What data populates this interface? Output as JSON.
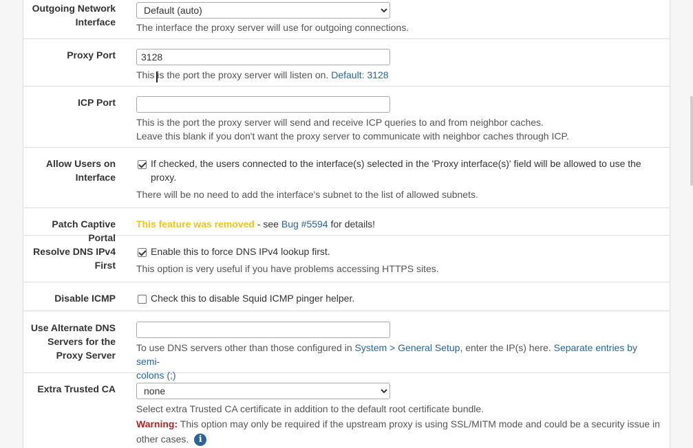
{
  "fields": {
    "outgoing_iface": {
      "label_line1": "Outgoing Network",
      "label_line2": "Interface",
      "selected": "Default (auto)",
      "help": "The interface the proxy server will use for outgoing connections."
    },
    "proxy_port": {
      "label": "Proxy Port",
      "value": "3128",
      "help": "This is the port the proxy server will listen on.",
      "help_default": "Default: 3128"
    },
    "icp_port": {
      "label": "ICP Port",
      "value": "",
      "help_line1": "This is the port the proxy server will send and receive ICP queries to and from neighbor caches.",
      "help_line2": "Leave this blank if you don't want the proxy server to communicate with neighbor caches through ICP."
    },
    "allow_users": {
      "label_line1": "Allow Users on",
      "label_line2": "Interface",
      "checked": true,
      "check_text_line1": "If checked, the users connected to the interface(s) selected in the 'Proxy interface(s)' field will be allowed to use the",
      "check_text_line2": "proxy.",
      "help": "There will be no need to add the interface's subnet to the list of allowed subnets."
    },
    "patch_captive": {
      "label": "Patch Captive Portal",
      "removed": "This feature was removed",
      "see": " - see ",
      "bug": "Bug #5594",
      "details": " for details!"
    },
    "resolve_dns": {
      "label_line1": "Resolve DNS IPv4",
      "label_line2": "First",
      "checked": true,
      "check_text": "Enable this to force DNS IPv4 lookup first.",
      "help": "This option is very useful if you have problems accessing HTTPS sites."
    },
    "disable_icmp": {
      "label": "Disable ICMP",
      "checked": false,
      "check_text": "Check this to disable Squid ICMP pinger helper."
    },
    "alt_dns": {
      "label_line1": "Use Alternate DNS",
      "label_line2": "Servers for the",
      "label_line3": "Proxy Server",
      "value": "",
      "help_pre": "To use DNS servers other than those configured in ",
      "help_link": "System > General Setup",
      "help_mid": ", enter the IP(s) here. ",
      "help_link2_line1": "Separate entries by semi-",
      "help_link2_line2": "colons (;)"
    },
    "extra_ca": {
      "label": "Extra Trusted CA",
      "selected": "none",
      "help": "Select extra Trusted CA certificate in addition to the default root certificate bundle.",
      "warn_label": "Warning:",
      "warn_text_line1": " This option may only be required if the upstream proxy is using SSL/MITM mode and could be a security issue in",
      "warn_text_line2": "other cases.",
      "info_glyph": "i"
    }
  }
}
